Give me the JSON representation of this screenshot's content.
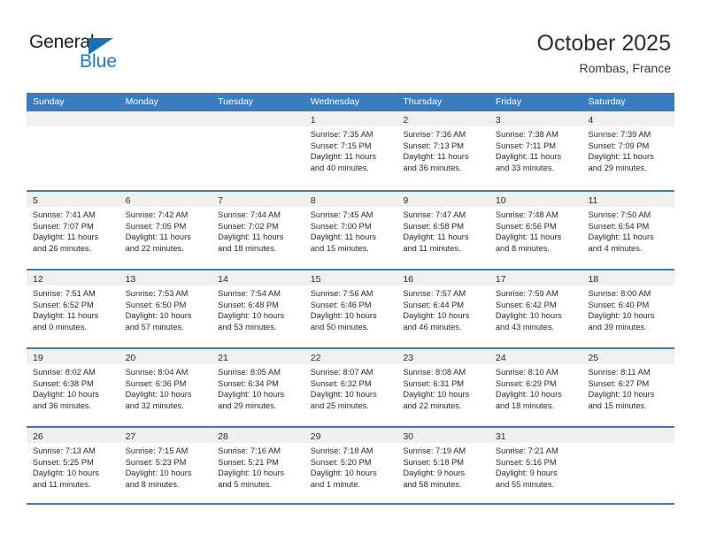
{
  "brand": {
    "name_top": "General",
    "name_bottom": "Blue",
    "logo_icon": "triangle-icon",
    "color_primary": "#2079c8",
    "color_dark": "#231f20"
  },
  "header": {
    "title": "October 2025",
    "location": "Rombas, France"
  },
  "calendar": {
    "header_bg": "#3a7cbe",
    "cell_head_bg": "#f0f0f0",
    "weekdays": [
      "Sunday",
      "Monday",
      "Tuesday",
      "Wednesday",
      "Thursday",
      "Friday",
      "Saturday"
    ],
    "weeks": [
      [
        {
          "day": "",
          "lines": []
        },
        {
          "day": "",
          "lines": []
        },
        {
          "day": "",
          "lines": []
        },
        {
          "day": "1",
          "lines": [
            "Sunrise: 7:35 AM",
            "Sunset: 7:15 PM",
            "Daylight: 11 hours",
            "and 40 minutes."
          ]
        },
        {
          "day": "2",
          "lines": [
            "Sunrise: 7:36 AM",
            "Sunset: 7:13 PM",
            "Daylight: 11 hours",
            "and 36 minutes."
          ]
        },
        {
          "day": "3",
          "lines": [
            "Sunrise: 7:38 AM",
            "Sunset: 7:11 PM",
            "Daylight: 11 hours",
            "and 33 minutes."
          ]
        },
        {
          "day": "4",
          "lines": [
            "Sunrise: 7:39 AM",
            "Sunset: 7:09 PM",
            "Daylight: 11 hours",
            "and 29 minutes."
          ]
        }
      ],
      [
        {
          "day": "5",
          "lines": [
            "Sunrise: 7:41 AM",
            "Sunset: 7:07 PM",
            "Daylight: 11 hours",
            "and 26 minutes."
          ]
        },
        {
          "day": "6",
          "lines": [
            "Sunrise: 7:42 AM",
            "Sunset: 7:05 PM",
            "Daylight: 11 hours",
            "and 22 minutes."
          ]
        },
        {
          "day": "7",
          "lines": [
            "Sunrise: 7:44 AM",
            "Sunset: 7:02 PM",
            "Daylight: 11 hours",
            "and 18 minutes."
          ]
        },
        {
          "day": "8",
          "lines": [
            "Sunrise: 7:45 AM",
            "Sunset: 7:00 PM",
            "Daylight: 11 hours",
            "and 15 minutes."
          ]
        },
        {
          "day": "9",
          "lines": [
            "Sunrise: 7:47 AM",
            "Sunset: 6:58 PM",
            "Daylight: 11 hours",
            "and 11 minutes."
          ]
        },
        {
          "day": "10",
          "lines": [
            "Sunrise: 7:48 AM",
            "Sunset: 6:56 PM",
            "Daylight: 11 hours",
            "and 8 minutes."
          ]
        },
        {
          "day": "11",
          "lines": [
            "Sunrise: 7:50 AM",
            "Sunset: 6:54 PM",
            "Daylight: 11 hours",
            "and 4 minutes."
          ]
        }
      ],
      [
        {
          "day": "12",
          "lines": [
            "Sunrise: 7:51 AM",
            "Sunset: 6:52 PM",
            "Daylight: 11 hours",
            "and 0 minutes."
          ]
        },
        {
          "day": "13",
          "lines": [
            "Sunrise: 7:53 AM",
            "Sunset: 6:50 PM",
            "Daylight: 10 hours",
            "and 57 minutes."
          ]
        },
        {
          "day": "14",
          "lines": [
            "Sunrise: 7:54 AM",
            "Sunset: 6:48 PM",
            "Daylight: 10 hours",
            "and 53 minutes."
          ]
        },
        {
          "day": "15",
          "lines": [
            "Sunrise: 7:56 AM",
            "Sunset: 6:46 PM",
            "Daylight: 10 hours",
            "and 50 minutes."
          ]
        },
        {
          "day": "16",
          "lines": [
            "Sunrise: 7:57 AM",
            "Sunset: 6:44 PM",
            "Daylight: 10 hours",
            "and 46 minutes."
          ]
        },
        {
          "day": "17",
          "lines": [
            "Sunrise: 7:59 AM",
            "Sunset: 6:42 PM",
            "Daylight: 10 hours",
            "and 43 minutes."
          ]
        },
        {
          "day": "18",
          "lines": [
            "Sunrise: 8:00 AM",
            "Sunset: 6:40 PM",
            "Daylight: 10 hours",
            "and 39 minutes."
          ]
        }
      ],
      [
        {
          "day": "19",
          "lines": [
            "Sunrise: 8:02 AM",
            "Sunset: 6:38 PM",
            "Daylight: 10 hours",
            "and 36 minutes."
          ]
        },
        {
          "day": "20",
          "lines": [
            "Sunrise: 8:04 AM",
            "Sunset: 6:36 PM",
            "Daylight: 10 hours",
            "and 32 minutes."
          ]
        },
        {
          "day": "21",
          "lines": [
            "Sunrise: 8:05 AM",
            "Sunset: 6:34 PM",
            "Daylight: 10 hours",
            "and 29 minutes."
          ]
        },
        {
          "day": "22",
          "lines": [
            "Sunrise: 8:07 AM",
            "Sunset: 6:32 PM",
            "Daylight: 10 hours",
            "and 25 minutes."
          ]
        },
        {
          "day": "23",
          "lines": [
            "Sunrise: 8:08 AM",
            "Sunset: 6:31 PM",
            "Daylight: 10 hours",
            "and 22 minutes."
          ]
        },
        {
          "day": "24",
          "lines": [
            "Sunrise: 8:10 AM",
            "Sunset: 6:29 PM",
            "Daylight: 10 hours",
            "and 18 minutes."
          ]
        },
        {
          "day": "25",
          "lines": [
            "Sunrise: 8:11 AM",
            "Sunset: 6:27 PM",
            "Daylight: 10 hours",
            "and 15 minutes."
          ]
        }
      ],
      [
        {
          "day": "26",
          "lines": [
            "Sunrise: 7:13 AM",
            "Sunset: 5:25 PM",
            "Daylight: 10 hours",
            "and 11 minutes."
          ]
        },
        {
          "day": "27",
          "lines": [
            "Sunrise: 7:15 AM",
            "Sunset: 5:23 PM",
            "Daylight: 10 hours",
            "and 8 minutes."
          ]
        },
        {
          "day": "28",
          "lines": [
            "Sunrise: 7:16 AM",
            "Sunset: 5:21 PM",
            "Daylight: 10 hours",
            "and 5 minutes."
          ]
        },
        {
          "day": "29",
          "lines": [
            "Sunrise: 7:18 AM",
            "Sunset: 5:20 PM",
            "Daylight: 10 hours",
            "and 1 minute."
          ]
        },
        {
          "day": "30",
          "lines": [
            "Sunrise: 7:19 AM",
            "Sunset: 5:18 PM",
            "Daylight: 9 hours",
            "and 58 minutes."
          ]
        },
        {
          "day": "31",
          "lines": [
            "Sunrise: 7:21 AM",
            "Sunset: 5:16 PM",
            "Daylight: 9 hours",
            "and 55 minutes."
          ]
        },
        {
          "day": "",
          "lines": []
        }
      ]
    ]
  }
}
